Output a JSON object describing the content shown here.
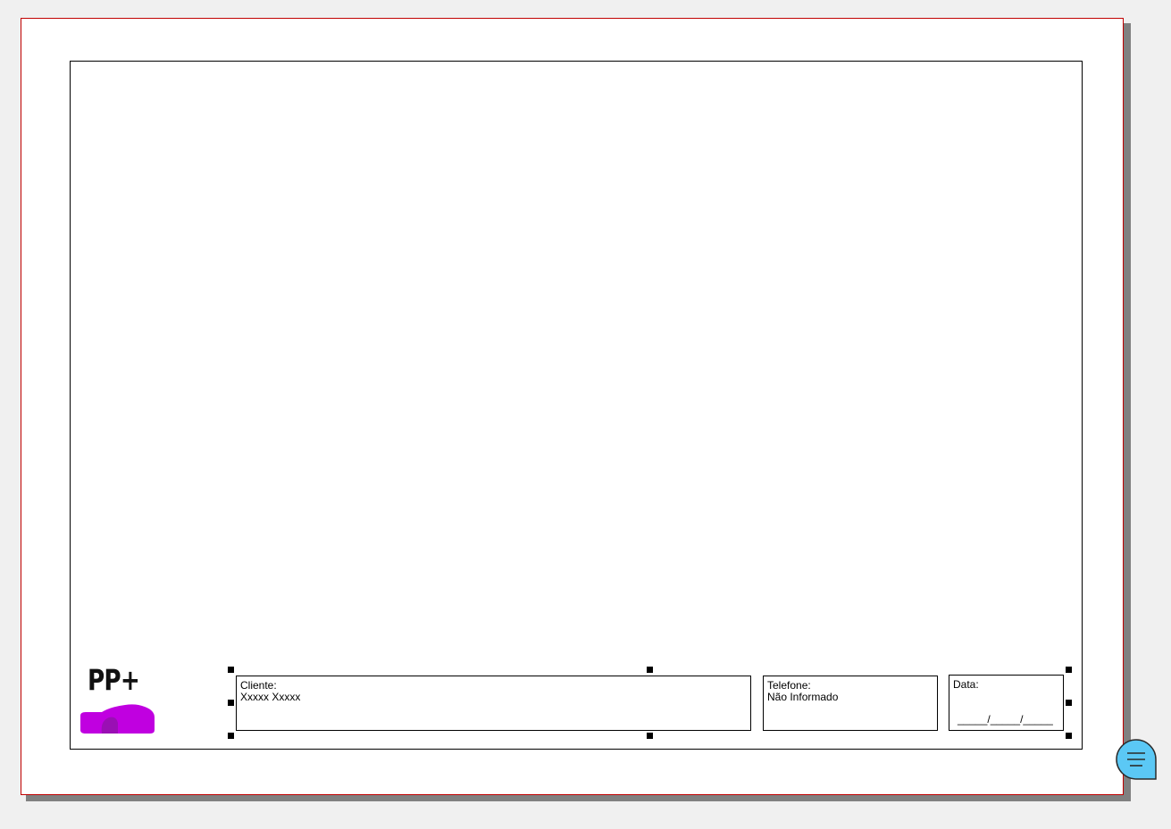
{
  "logo": {
    "text": "PP+",
    "accent_color": "#c000e0"
  },
  "fields": {
    "cliente": {
      "label": "Cliente:",
      "value": "Xxxxx Xxxxx"
    },
    "telefone": {
      "label": "Telefone:",
      "value": "Não Informado"
    },
    "data": {
      "label": "Data:",
      "value": "_____/_____/_____"
    }
  },
  "chat_button": {
    "icon": "chat-menu-icon",
    "color": "#5bc8f5"
  }
}
